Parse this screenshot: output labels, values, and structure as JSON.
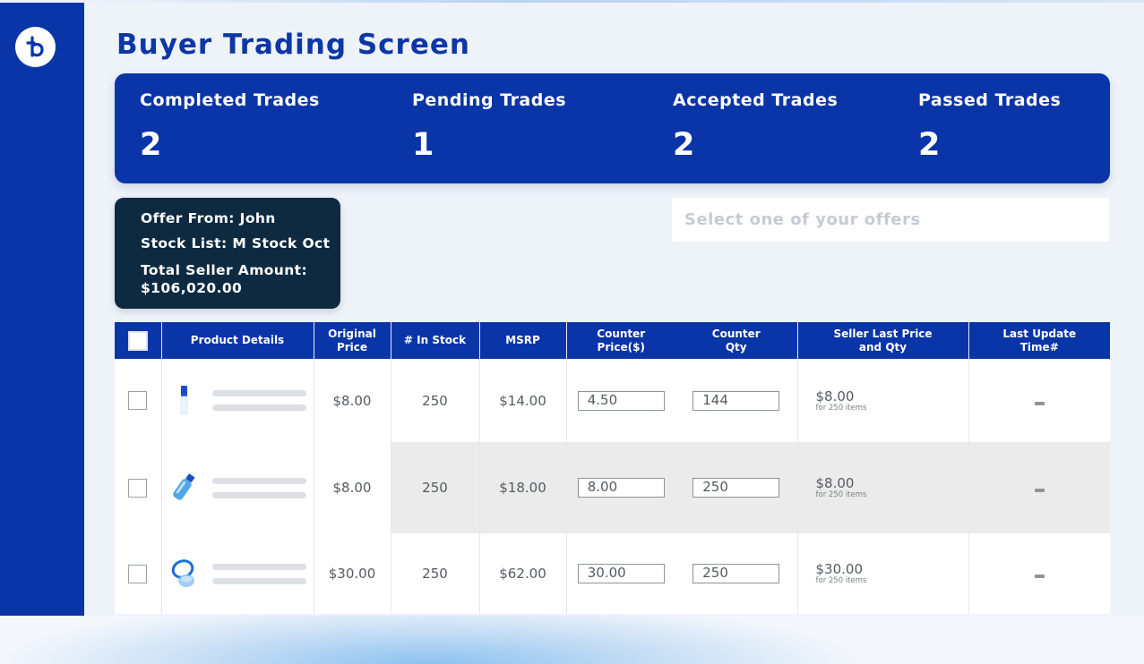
{
  "app": {
    "page_title": "Buyer Trading Screen"
  },
  "colors": {
    "primary": "#0a35a8",
    "card": "#0d2a41",
    "title": "#0c37a6"
  },
  "stats": [
    {
      "label": "Completed Trades",
      "value": "2"
    },
    {
      "label": "Pending Trades",
      "value": "1"
    },
    {
      "label": "Accepted Trades",
      "value": "2"
    },
    {
      "label": "Passed Trades",
      "value": "2"
    }
  ],
  "offer": {
    "from": "Offer From: John",
    "stock_list": "Stock List: M Stock Oct",
    "total_label": "Total Seller Amount:",
    "total_value": "$106,020.00"
  },
  "offer_select": {
    "placeholder": "Select one of your offers"
  },
  "table": {
    "headers": {
      "product": "Product Details",
      "orig_price_1": "Original",
      "orig_price_2": "Price",
      "in_stock": "# In Stock",
      "msrp": "MSRP",
      "counter_price_1": "Counter",
      "counter_price_2": "Price($)",
      "counter_qty_1": "Counter",
      "counter_qty_2": "Qty",
      "seller_last_1": "Seller Last Price",
      "seller_last_2": "and Qty",
      "last_update_1": "Last Update",
      "last_update_2": "Time#"
    },
    "rows": [
      {
        "product_icon": "bottle-icon",
        "original_price": "$8.00",
        "in_stock": "250",
        "msrp": "$14.00",
        "counter_price": "4.50",
        "counter_qty": "144",
        "seller_price": "$8.00",
        "seller_note": "for 250 items"
      },
      {
        "product_icon": "spray-icon",
        "original_price": "$8.00",
        "in_stock": "250",
        "msrp": "$18.00",
        "counter_price": "8.00",
        "counter_qty": "250",
        "seller_price": "$8.00",
        "seller_note": "for 250 items"
      },
      {
        "product_icon": "bowl-icon",
        "original_price": "$30.00",
        "in_stock": "250",
        "msrp": "$62.00",
        "counter_price": "30.00",
        "counter_qty": "250",
        "seller_price": "$30.00",
        "seller_note": "for 250 items"
      }
    ]
  }
}
